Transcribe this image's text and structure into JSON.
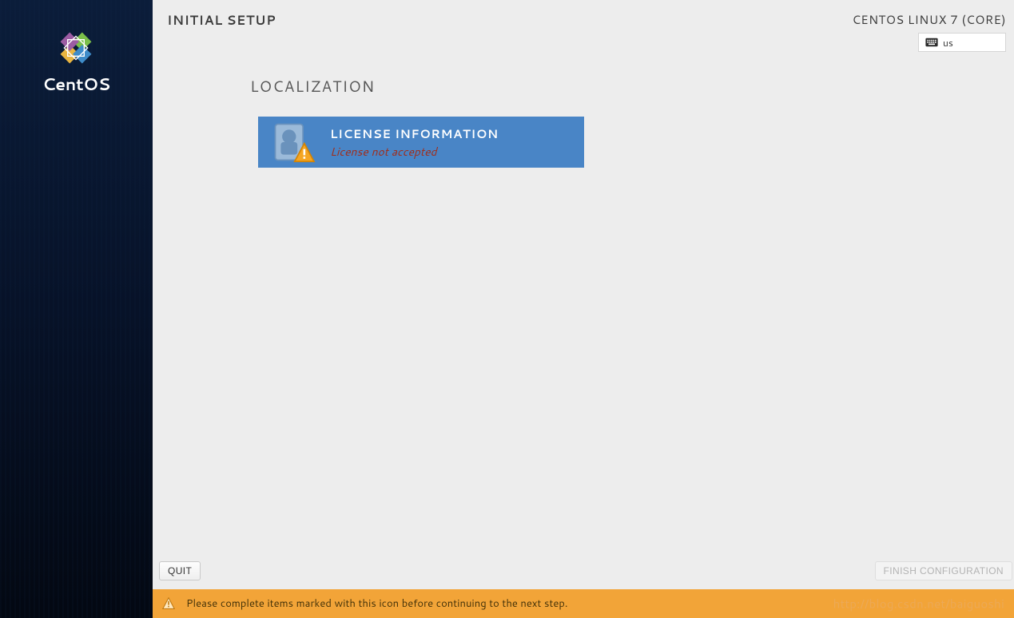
{
  "sidebar": {
    "brand": "CentOS"
  },
  "header": {
    "title": "INITIAL SETUP",
    "distro": "CENTOS LINUX 7 (CORE)",
    "keyboard_layout": "us"
  },
  "content": {
    "section_title": "LOCALIZATION",
    "license": {
      "title": "LICENSE INFORMATION",
      "status": "License not accepted"
    }
  },
  "buttons": {
    "quit": "QUIT",
    "finish": "FINISH CONFIGURATION"
  },
  "footer": {
    "message": "Please complete items marked with this icon before continuing to the next step.",
    "watermark": "http://blog.csdn.net/baiguoshi"
  }
}
